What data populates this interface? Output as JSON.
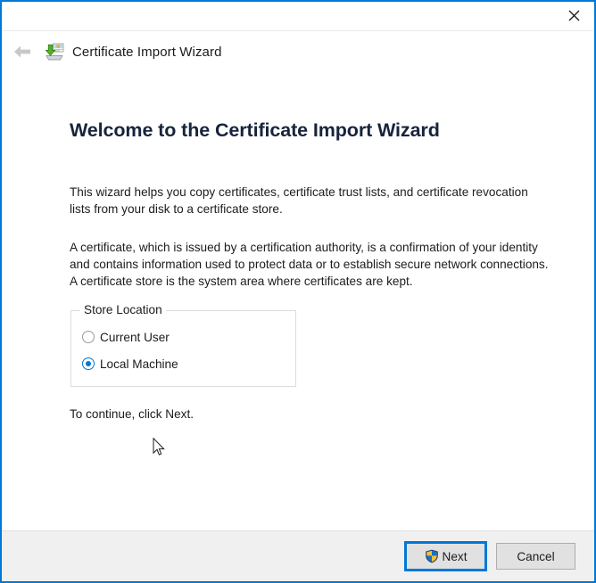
{
  "window": {
    "border_color": "#0078d7",
    "close_label": "Close"
  },
  "titlebar": {
    "back_label": "Back",
    "icon_name": "certificate-import-icon",
    "title": "Certificate Import Wizard"
  },
  "content": {
    "heading": "Welcome to the Certificate Import Wizard",
    "paragraph_1": "This wizard helps you copy certificates, certificate trust lists, and certificate revocation lists from your disk to a certificate store.",
    "paragraph_2": "A certificate, which is issued by a certification authority, is a confirmation of your identity and contains information used to protect data or to establish secure network connections. A certificate store is the system area where certificates are kept.",
    "continue_text": "To continue, click Next."
  },
  "store_location": {
    "legend": "Store Location",
    "options": [
      {
        "label": "Current User",
        "selected": false
      },
      {
        "label": "Local Machine",
        "selected": true
      }
    ]
  },
  "footer": {
    "next_label": "Next",
    "cancel_label": "Cancel",
    "next_has_shield": true,
    "accent_color": "#0078d7"
  }
}
